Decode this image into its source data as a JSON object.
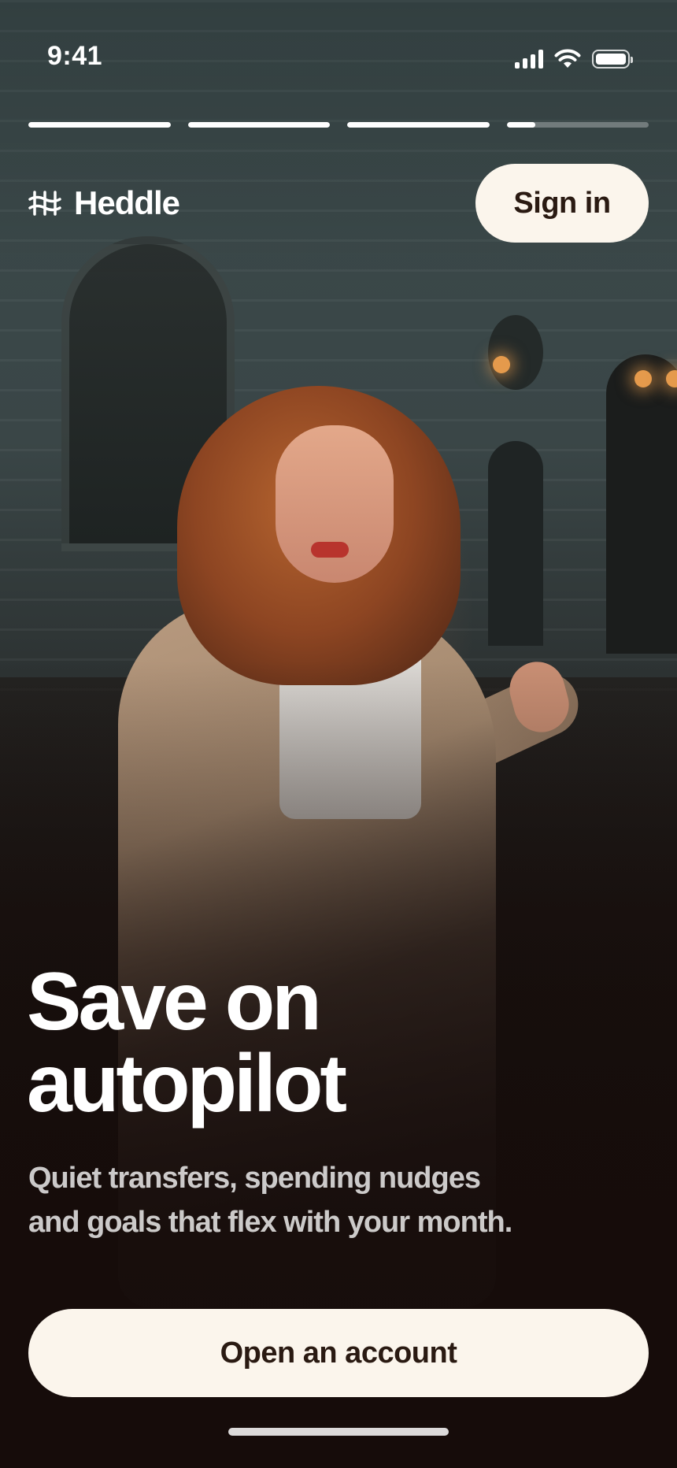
{
  "status_bar": {
    "time": "9:41",
    "icons": [
      "cellular-signal-icon",
      "wifi-icon",
      "battery-icon"
    ]
  },
  "story_progress": {
    "segments": [
      {
        "fill": 1.0
      },
      {
        "fill": 1.0
      },
      {
        "fill": 1.0
      },
      {
        "fill": 0.2
      }
    ]
  },
  "header": {
    "brand_name": "Heddle",
    "brand_icon": "heddle-logo-icon",
    "sign_in_label": "Sign in"
  },
  "hero": {
    "headline_line1": "Save on",
    "headline_line2": "autopilot",
    "subtitle_line1": "Quiet transfers, spending nudges",
    "subtitle_line2": "and goals that flex with your month."
  },
  "cta": {
    "label": "Open an account"
  },
  "colors": {
    "button_bg": "#fbf5ec",
    "button_text": "#2a1a12",
    "text_primary": "#ffffff"
  }
}
